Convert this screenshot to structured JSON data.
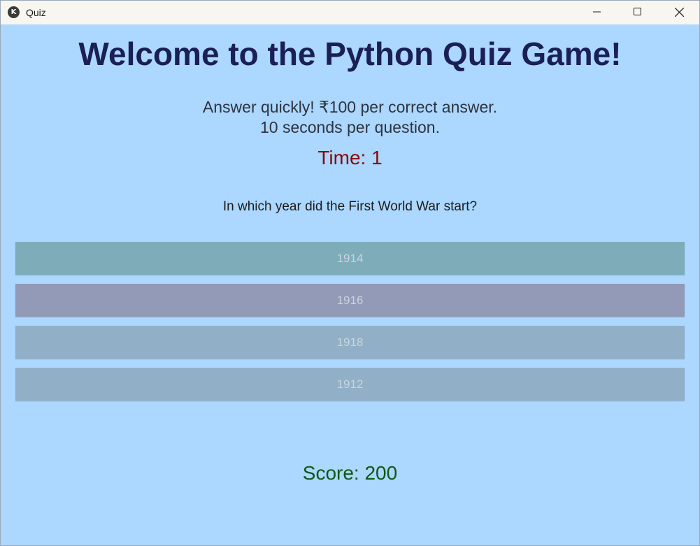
{
  "window": {
    "title": "Quiz",
    "icon": "kivy-logo-icon"
  },
  "heading": "Welcome to the Python Quiz Game!",
  "intro": {
    "line1": "Answer quickly! ₹100 per correct answer.",
    "line2": "10 seconds per question."
  },
  "timer": "Time: 1",
  "question": "In which year did the First World War start?",
  "options": [
    {
      "label": "1914",
      "color": "#7eacb9"
    },
    {
      "label": "1916",
      "color": "#929ab7"
    },
    {
      "label": "1918",
      "color": "#91b0c7"
    },
    {
      "label": "1912",
      "color": "#91b0c7"
    }
  ],
  "score": "Score: 200",
  "colors": {
    "background": "#acd7fe",
    "heading": "#1a1f55",
    "timer": "#880808",
    "score": "#0d5a16"
  }
}
